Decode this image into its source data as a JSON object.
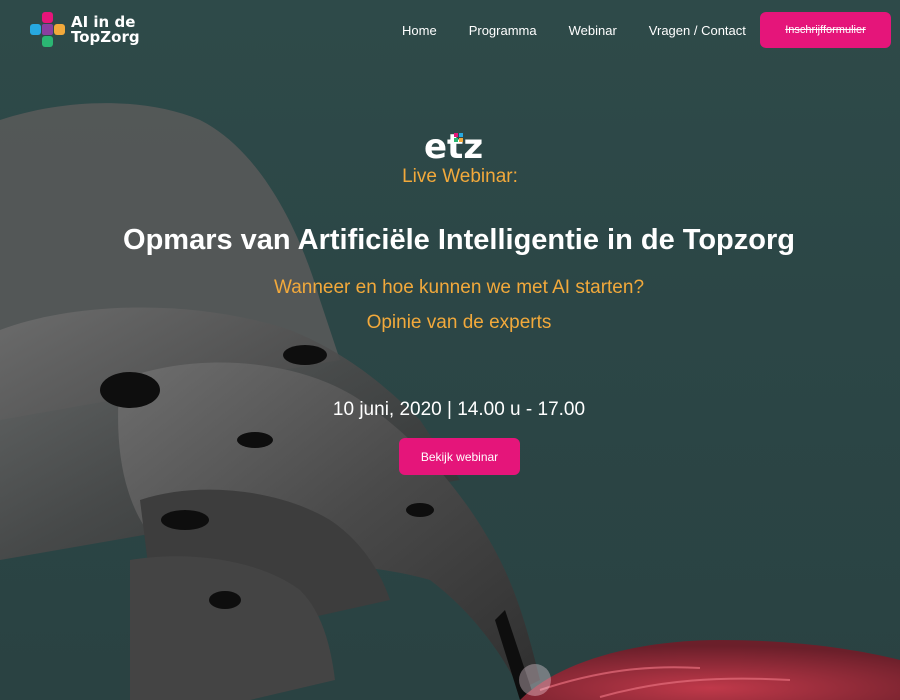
{
  "brand": {
    "logo_line1": "AI in de",
    "logo_line2": "TopZorg",
    "logo_colors": [
      "#e5157a",
      "#2bb673",
      "#27a9e1",
      "#f2a93b",
      "#8a3fa0"
    ]
  },
  "nav": {
    "items": [
      {
        "label": "Home"
      },
      {
        "label": "Programma"
      },
      {
        "label": "Webinar"
      },
      {
        "label": "Vragen / Contact"
      }
    ],
    "cta_label": "Inschrijfformulier"
  },
  "hero": {
    "partner_logo_text": "etz",
    "eyebrow": "Live Webinar:",
    "title": "Opmars van Artificiële Intelligentie in de Topzorg",
    "subtitle_1": "Wanneer en hoe kunnen we met AI starten?",
    "subtitle_2": "Opinie van de experts",
    "date": "10 juni, 2020 | 14.00 u - 17.00",
    "button_label": "Bekijk webinar"
  },
  "colors": {
    "background": "#2c4746",
    "accent_pink": "#e5157a",
    "accent_orange": "#f2a93b",
    "text": "#ffffff"
  }
}
